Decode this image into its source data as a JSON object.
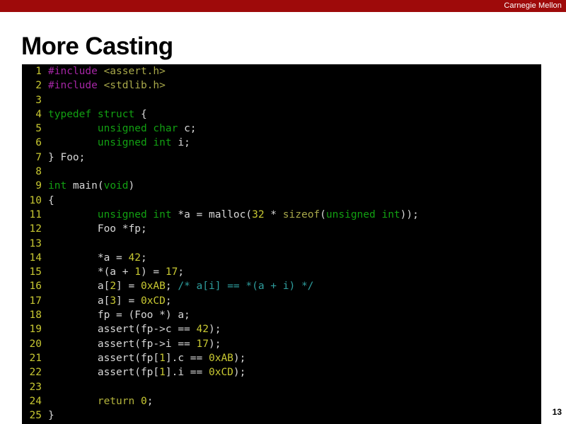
{
  "banner": {
    "label": "Carnegie Mellon",
    "color": "#9e0a0a"
  },
  "slide": {
    "title": "More Casting",
    "number": "13"
  },
  "code": {
    "language": "c",
    "background": "#000000",
    "line_number_color": "#c8c832",
    "lines": [
      {
        "n": "1",
        "tokens": [
          {
            "t": "#include ",
            "c": "pre"
          },
          {
            "t": "<assert.h>",
            "c": "header"
          }
        ]
      },
      {
        "n": "2",
        "tokens": [
          {
            "t": "#include ",
            "c": "pre"
          },
          {
            "t": "<stdlib.h>",
            "c": "header"
          }
        ]
      },
      {
        "n": "3",
        "tokens": []
      },
      {
        "n": "4",
        "tokens": [
          {
            "t": "typedef struct",
            "c": "kw"
          },
          {
            "t": " {",
            "c": "plain"
          }
        ]
      },
      {
        "n": "5",
        "tokens": [
          {
            "t": "        ",
            "c": "plain"
          },
          {
            "t": "unsigned char",
            "c": "kw"
          },
          {
            "t": " c;",
            "c": "plain"
          }
        ]
      },
      {
        "n": "6",
        "tokens": [
          {
            "t": "        ",
            "c": "plain"
          },
          {
            "t": "unsigned int",
            "c": "kw"
          },
          {
            "t": " i;",
            "c": "plain"
          }
        ]
      },
      {
        "n": "7",
        "tokens": [
          {
            "t": "} Foo;",
            "c": "plain"
          }
        ]
      },
      {
        "n": "8",
        "tokens": []
      },
      {
        "n": "9",
        "tokens": [
          {
            "t": "int",
            "c": "kw"
          },
          {
            "t": " main(",
            "c": "plain"
          },
          {
            "t": "void",
            "c": "kw"
          },
          {
            "t": ")",
            "c": "plain"
          }
        ]
      },
      {
        "n": "10",
        "tokens": [
          {
            "t": "{",
            "c": "plain"
          }
        ]
      },
      {
        "n": "11",
        "tokens": [
          {
            "t": "        ",
            "c": "plain"
          },
          {
            "t": "unsigned int",
            "c": "kw"
          },
          {
            "t": " *a = malloc(",
            "c": "plain"
          },
          {
            "t": "32",
            "c": "num"
          },
          {
            "t": " * ",
            "c": "plain"
          },
          {
            "t": "sizeof",
            "c": "builtin"
          },
          {
            "t": "(",
            "c": "plain"
          },
          {
            "t": "unsigned int",
            "c": "kw"
          },
          {
            "t": "));",
            "c": "plain"
          }
        ]
      },
      {
        "n": "12",
        "tokens": [
          {
            "t": "        Foo *fp;",
            "c": "plain"
          }
        ]
      },
      {
        "n": "13",
        "tokens": []
      },
      {
        "n": "14",
        "tokens": [
          {
            "t": "        *a = ",
            "c": "plain"
          },
          {
            "t": "42",
            "c": "num"
          },
          {
            "t": ";",
            "c": "plain"
          }
        ]
      },
      {
        "n": "15",
        "tokens": [
          {
            "t": "        *(a + ",
            "c": "plain"
          },
          {
            "t": "1",
            "c": "num"
          },
          {
            "t": ") = ",
            "c": "plain"
          },
          {
            "t": "17",
            "c": "num"
          },
          {
            "t": ";",
            "c": "plain"
          }
        ]
      },
      {
        "n": "16",
        "tokens": [
          {
            "t": "        a[",
            "c": "plain"
          },
          {
            "t": "2",
            "c": "num"
          },
          {
            "t": "] = ",
            "c": "plain"
          },
          {
            "t": "0xAB",
            "c": "hex"
          },
          {
            "t": "; ",
            "c": "plain"
          },
          {
            "t": "/* a[i] == *(a + i) */",
            "c": "comment"
          }
        ]
      },
      {
        "n": "17",
        "tokens": [
          {
            "t": "        a[",
            "c": "plain"
          },
          {
            "t": "3",
            "c": "num"
          },
          {
            "t": "] = ",
            "c": "plain"
          },
          {
            "t": "0xCD",
            "c": "hex"
          },
          {
            "t": ";",
            "c": "plain"
          }
        ]
      },
      {
        "n": "18",
        "tokens": [
          {
            "t": "        fp = (Foo *) a;",
            "c": "plain"
          }
        ]
      },
      {
        "n": "19",
        "tokens": [
          {
            "t": "        assert(fp->c == ",
            "c": "plain"
          },
          {
            "t": "42",
            "c": "num"
          },
          {
            "t": ");",
            "c": "plain"
          }
        ]
      },
      {
        "n": "20",
        "tokens": [
          {
            "t": "        assert(fp->i == ",
            "c": "plain"
          },
          {
            "t": "17",
            "c": "num"
          },
          {
            "t": ");",
            "c": "plain"
          }
        ]
      },
      {
        "n": "21",
        "tokens": [
          {
            "t": "        assert(fp[",
            "c": "plain"
          },
          {
            "t": "1",
            "c": "num"
          },
          {
            "t": "].c == ",
            "c": "plain"
          },
          {
            "t": "0xAB",
            "c": "hex"
          },
          {
            "t": ");",
            "c": "plain"
          }
        ]
      },
      {
        "n": "22",
        "tokens": [
          {
            "t": "        assert(fp[",
            "c": "plain"
          },
          {
            "t": "1",
            "c": "num"
          },
          {
            "t": "].i == ",
            "c": "plain"
          },
          {
            "t": "0xCD",
            "c": "hex"
          },
          {
            "t": ");",
            "c": "plain"
          }
        ]
      },
      {
        "n": "23",
        "tokens": []
      },
      {
        "n": "24",
        "tokens": [
          {
            "t": "        ",
            "c": "plain"
          },
          {
            "t": "return",
            "c": "return"
          },
          {
            "t": " ",
            "c": "plain"
          },
          {
            "t": "0",
            "c": "num"
          },
          {
            "t": ";",
            "c": "plain"
          }
        ]
      },
      {
        "n": "25",
        "tokens": [
          {
            "t": "}",
            "c": "plain"
          }
        ]
      }
    ]
  }
}
